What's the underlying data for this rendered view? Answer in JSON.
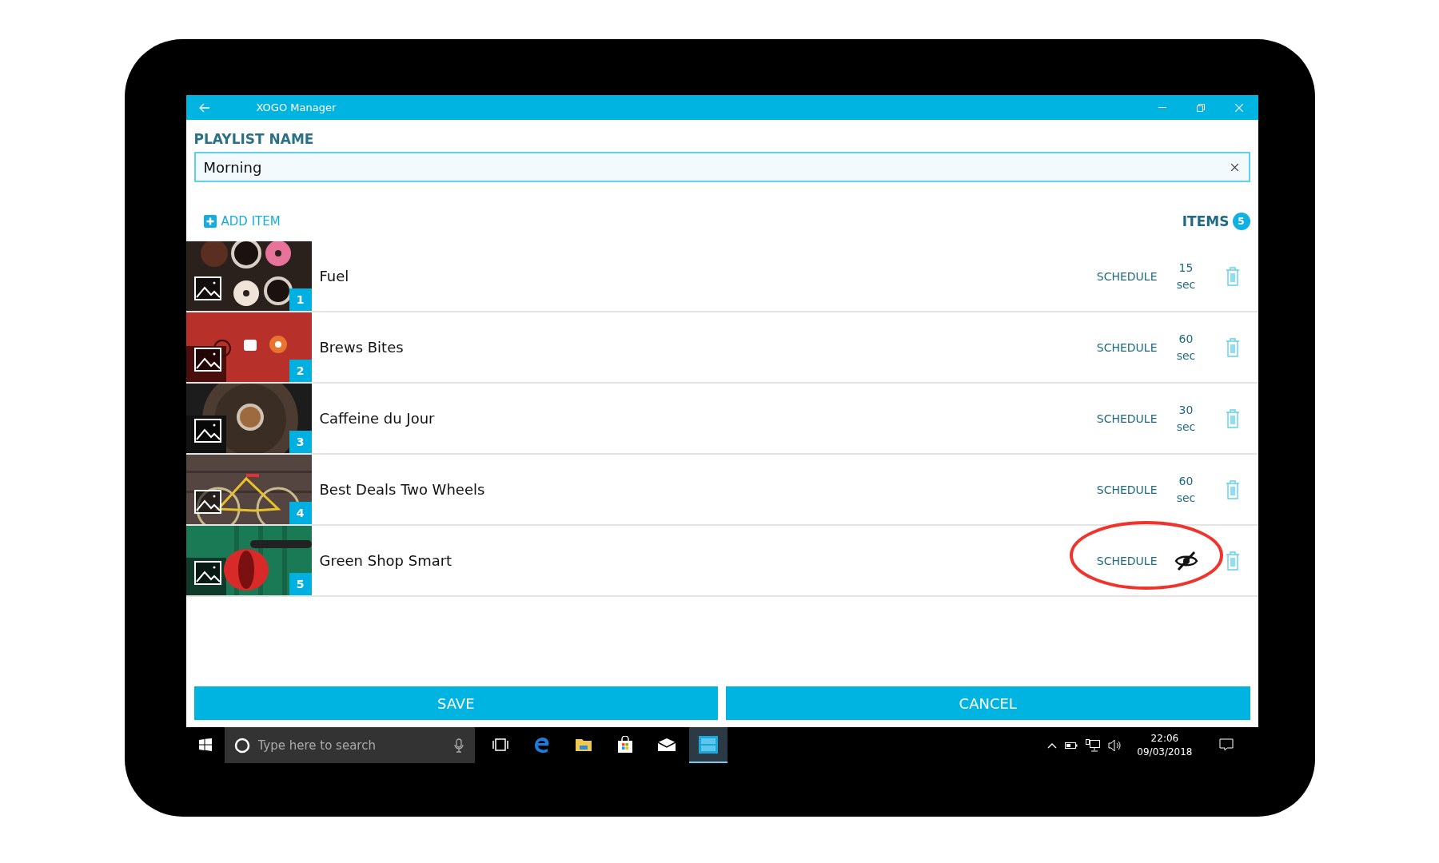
{
  "window": {
    "title": "XOGO Manager"
  },
  "playlist": {
    "label": "PLAYLIST NAME",
    "value": "Morning"
  },
  "add_item": "ADD ITEM",
  "items_count": {
    "label": "ITEMS",
    "count": "5"
  },
  "rows": [
    {
      "number": "1",
      "name": "Fuel",
      "schedule": "SCHEDULE",
      "kind": "duration",
      "duration": "15",
      "unit": "sec",
      "annotated": false
    },
    {
      "number": "2",
      "name": "Brews Bites",
      "schedule": "SCHEDULE",
      "kind": "duration",
      "duration": "60",
      "unit": "sec",
      "annotated": false
    },
    {
      "number": "3",
      "name": "Caffeine du Jour",
      "schedule": "SCHEDULE",
      "kind": "duration",
      "duration": "30",
      "unit": "sec",
      "annotated": false
    },
    {
      "number": "4",
      "name": "Best Deals Two Wheels",
      "schedule": "SCHEDULE",
      "kind": "duration",
      "duration": "60",
      "unit": "sec",
      "annotated": false
    },
    {
      "number": "5",
      "name": "Green Shop Smart",
      "schedule": "SCHEDULE",
      "kind": "hidden",
      "annotated": true
    }
  ],
  "buttons": [
    {
      "label": "SAVE"
    },
    {
      "label": "CANCEL"
    }
  ],
  "taskbar": {
    "search_placeholder": "Type here to search",
    "apps": [
      {
        "kind": "task-view",
        "selected": false
      },
      {
        "kind": "browser",
        "selected": false
      },
      {
        "kind": "folder",
        "selected": false
      },
      {
        "kind": "store",
        "selected": false
      },
      {
        "kind": "mail",
        "selected": false
      },
      {
        "kind": "app",
        "selected": true
      }
    ],
    "time": "22:06",
    "date": "09/03/2018"
  }
}
